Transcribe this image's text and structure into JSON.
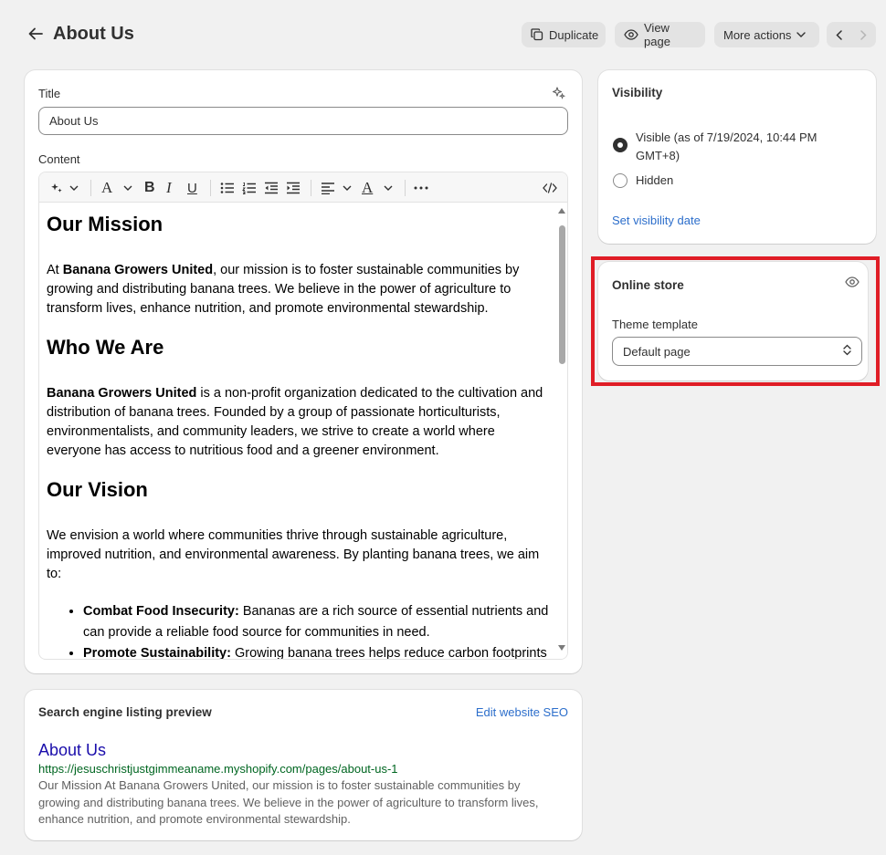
{
  "header": {
    "title": "About Us",
    "duplicate_label": "Duplicate",
    "view_page_label": "View page",
    "more_actions_label": "More actions"
  },
  "editor": {
    "title_label": "Title",
    "title_value": "About Us",
    "content_label": "Content",
    "sections": {
      "mission_heading": "Our Mission",
      "mission_p_pre": "At ",
      "mission_p_bold": "Banana Growers United",
      "mission_p_post": ", our mission is to foster sustainable communities by growing and distributing banana trees. We believe in the power of agriculture to transform lives, enhance nutrition, and promote environmental stewardship.",
      "who_heading": "Who We Are",
      "who_p_bold": "Banana Growers United",
      "who_p_post": " is a non-profit organization dedicated to the cultivation and distribution of banana trees. Founded by a group of passionate horticulturists, environmentalists, and community leaders, we strive to create a world where everyone has access to nutritious food and a greener environment.",
      "vision_heading": "Our Vision",
      "vision_p": "We envision a world where communities thrive through sustainable agriculture, improved nutrition, and environmental awareness. By planting banana trees, we aim to:",
      "bullets": [
        {
          "bold": "Combat Food Insecurity:",
          "text": " Bananas are a rich source of essential nutrients and can provide a reliable food source for communities in need."
        },
        {
          "bold": "Promote Sustainability:",
          "text": " Growing banana trees helps reduce carbon footprints and is compatible with crop rotation to reduce soil erosion."
        }
      ]
    }
  },
  "seo": {
    "heading": "Search engine listing preview",
    "edit_label": "Edit website SEO",
    "title": "About Us",
    "url": "https://jesuschristjustgimmeaname.myshopify.com/pages/about-us-1",
    "description": "Our Mission At Banana Growers United, our mission is to foster sustainable communities by growing and distributing banana trees. We believe in the power of agriculture to transform lives, enhance nutrition, and promote environmental stewardship."
  },
  "visibility": {
    "heading": "Visibility",
    "visible_label": "Visible (as of 7/19/2024, 10:44 PM GMT+8)",
    "hidden_label": "Hidden",
    "set_date_label": "Set visibility date",
    "selected": "visible"
  },
  "online_store": {
    "heading": "Online store",
    "theme_label": "Theme template",
    "theme_value": "Default page",
    "highlight_color": "#e01d26"
  },
  "colors": {
    "background": "#f1f1f1",
    "link": "#2c6ecb",
    "seo_title": "#1a0dab",
    "seo_url": "#006621"
  }
}
